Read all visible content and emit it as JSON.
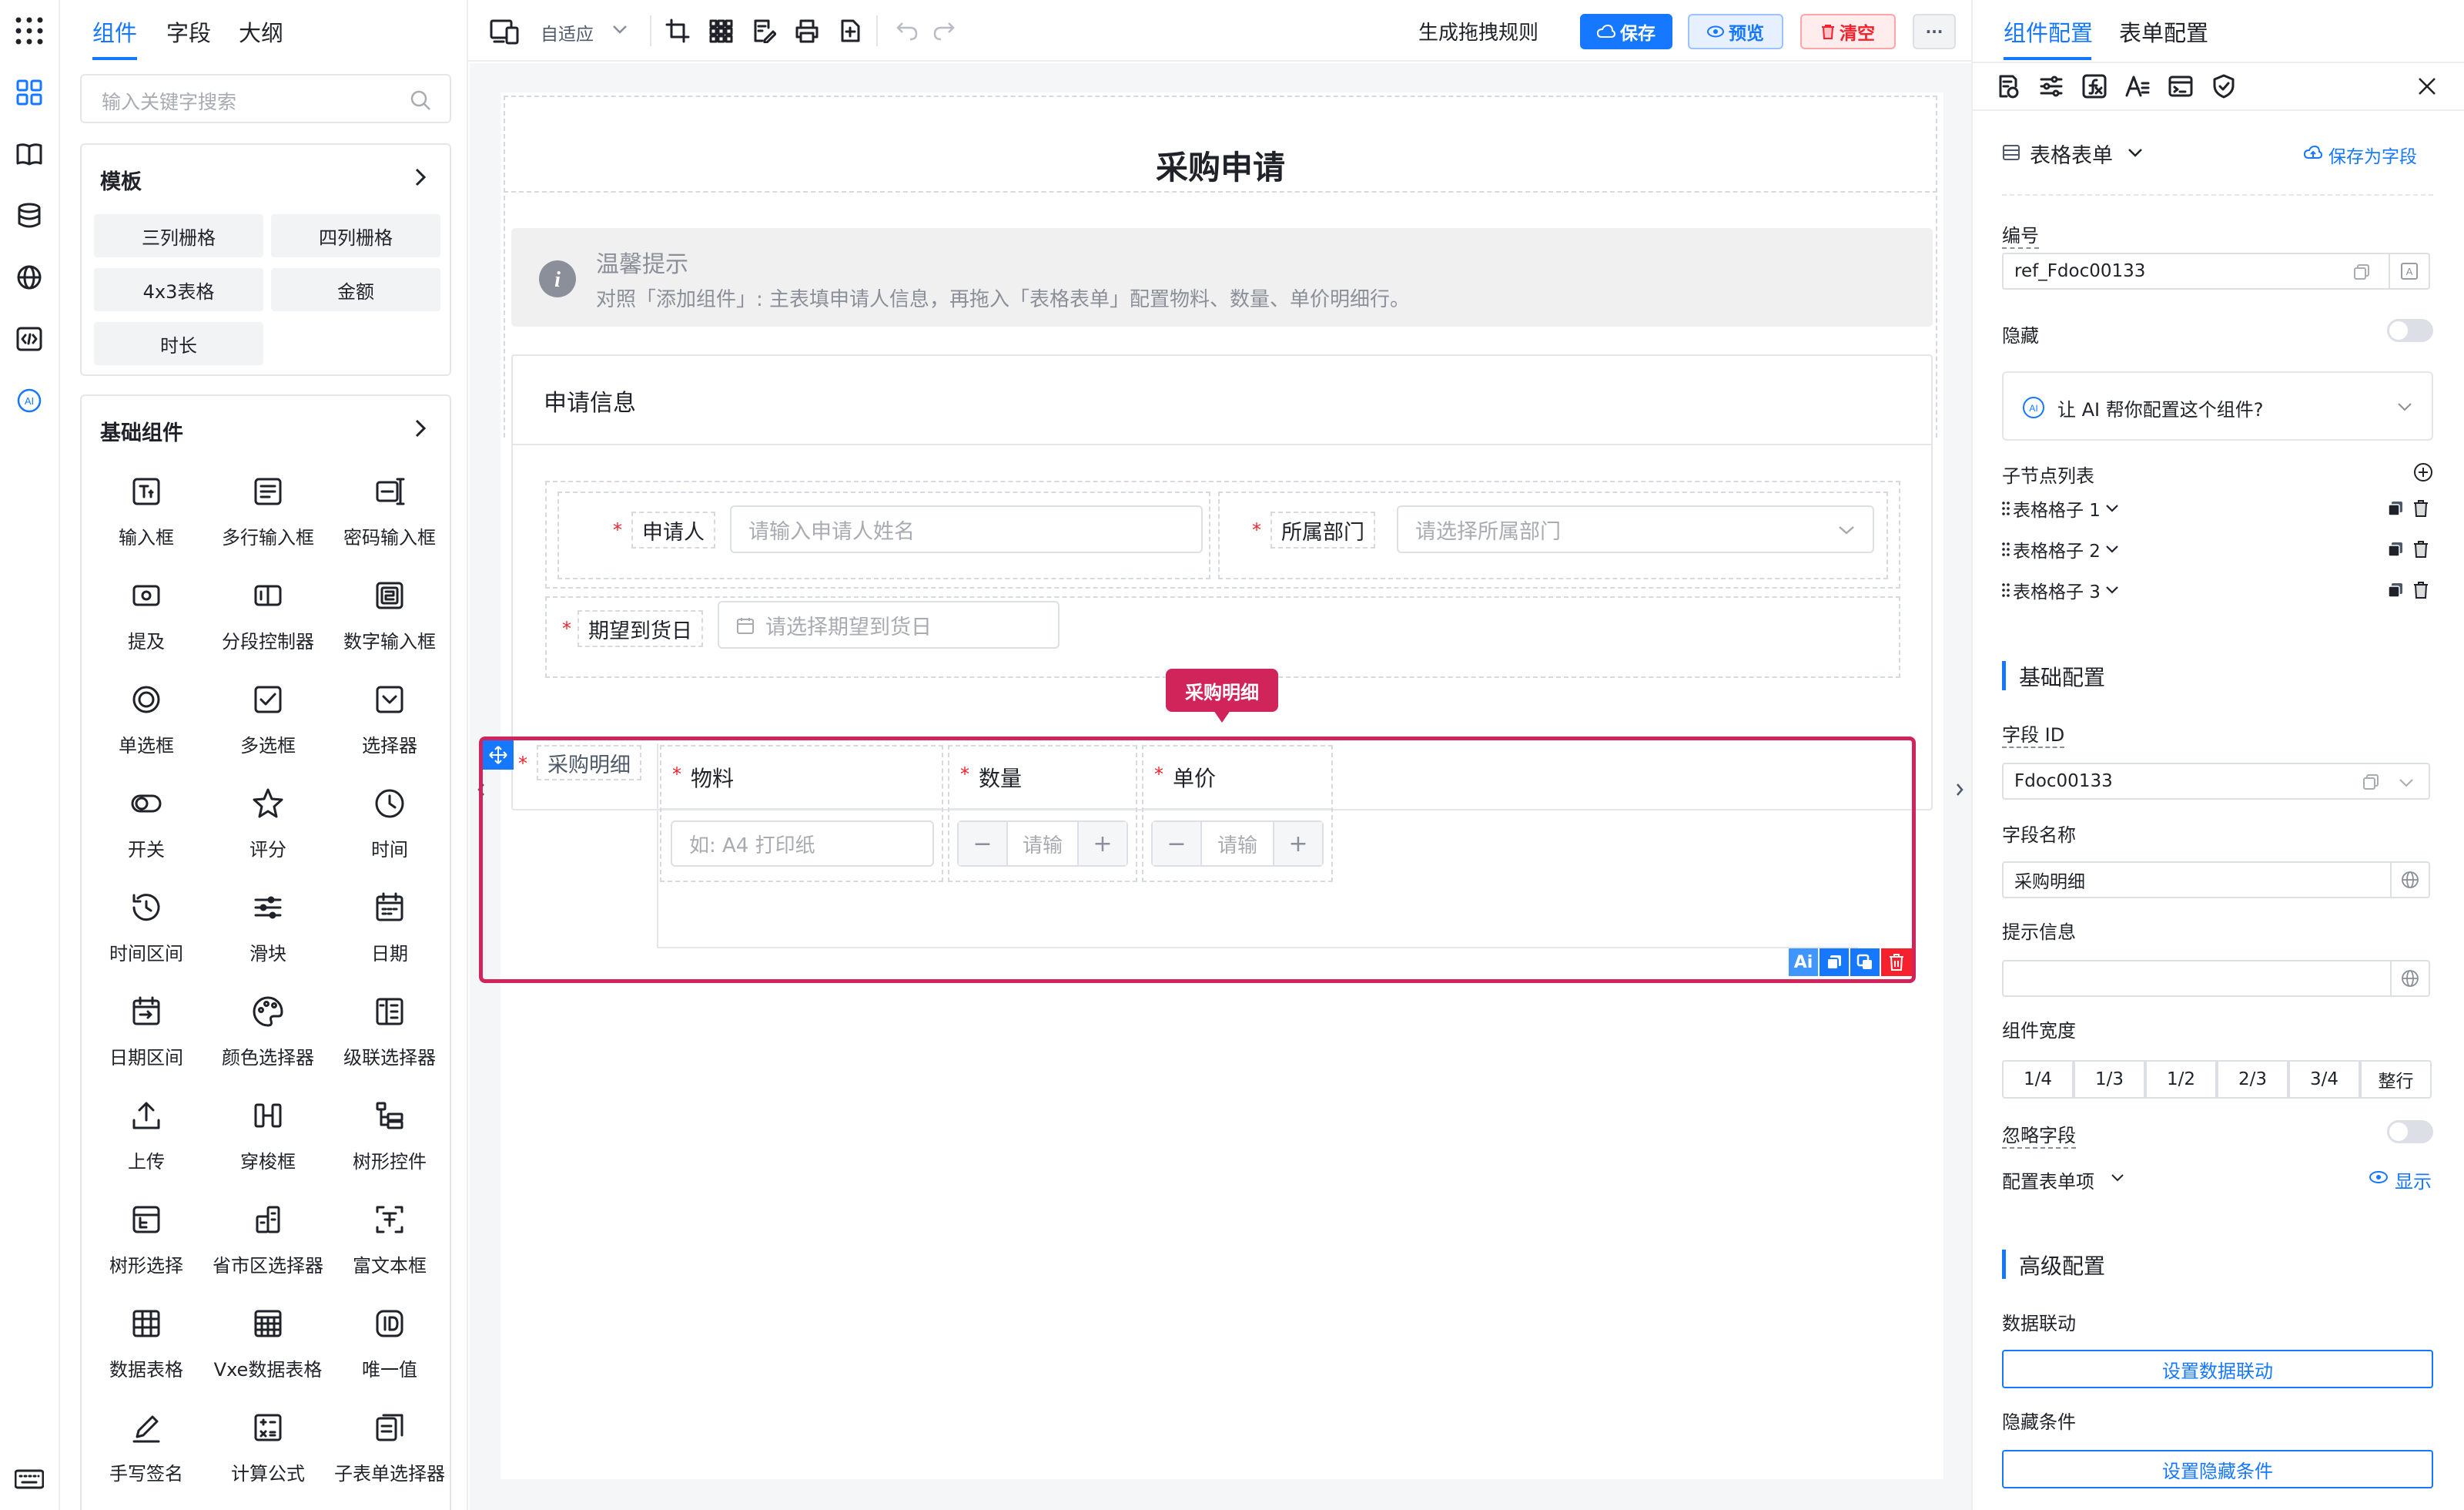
{
  "left_tabs": [
    "组件",
    "字段",
    "大纲"
  ],
  "search": {
    "placeholder": "输入关键字搜索"
  },
  "templates": {
    "title": "模板",
    "items": [
      "三列栅格",
      "四列栅格",
      "4x3表格",
      "金额",
      "时长"
    ]
  },
  "basic": {
    "title": "基础组件",
    "items": [
      {
        "label": "输入框",
        "icon": "input-icon"
      },
      {
        "label": "多行输入框",
        "icon": "textarea-icon"
      },
      {
        "label": "密码输入框",
        "icon": "password-icon"
      },
      {
        "label": "提及",
        "icon": "mention-icon"
      },
      {
        "label": "分段控制器",
        "icon": "segmented-icon"
      },
      {
        "label": "数字输入框",
        "icon": "number-icon"
      },
      {
        "label": "单选框",
        "icon": "radio-icon"
      },
      {
        "label": "多选框",
        "icon": "checkbox-icon"
      },
      {
        "label": "选择器",
        "icon": "select-icon"
      },
      {
        "label": "开关",
        "icon": "switch-icon"
      },
      {
        "label": "评分",
        "icon": "star-icon"
      },
      {
        "label": "时间",
        "icon": "clock-icon"
      },
      {
        "label": "时间区间",
        "icon": "history-icon"
      },
      {
        "label": "滑块",
        "icon": "slider-icon"
      },
      {
        "label": "日期",
        "icon": "calendar-icon"
      },
      {
        "label": "日期区间",
        "icon": "date-range-icon"
      },
      {
        "label": "颜色选择器",
        "icon": "palette-icon"
      },
      {
        "label": "级联选择器",
        "icon": "cascader-icon"
      },
      {
        "label": "上传",
        "icon": "upload-icon"
      },
      {
        "label": "穿梭框",
        "icon": "transfer-icon"
      },
      {
        "label": "树形控件",
        "icon": "tree-icon"
      },
      {
        "label": "树形选择",
        "icon": "tree-select-icon"
      },
      {
        "label": "省市区选择器",
        "icon": "region-icon"
      },
      {
        "label": "富文本框",
        "icon": "rich-text-icon"
      },
      {
        "label": "数据表格",
        "icon": "table-icon"
      },
      {
        "label": "Vxe数据表格",
        "icon": "vxe-table-icon"
      },
      {
        "label": "唯一值",
        "icon": "id-icon"
      },
      {
        "label": "手写签名",
        "icon": "signature-icon"
      },
      {
        "label": "计算公式",
        "icon": "calculator-icon"
      },
      {
        "label": "子表单选择器",
        "icon": "subform-icon"
      }
    ]
  },
  "toolbar": {
    "adaptive": "自适应",
    "gen_rules": "生成拖拽规则",
    "save": "保存",
    "preview": "预览",
    "clear": "清空",
    "more": "···"
  },
  "form": {
    "title": "采购申请",
    "tip": {
      "title": "温馨提示",
      "text": "对照「添加组件」: 主表填申请人信息，再拖入「表格表单」配置物料、数量、单价明细行。"
    },
    "section_title": "申请信息",
    "applicant": {
      "label": "申请人",
      "placeholder": "请输入申请人姓名"
    },
    "department": {
      "label": "所属部门",
      "placeholder": "请选择所属部门"
    },
    "delivery": {
      "label": "期望到货日",
      "placeholder": "请选择期望到货日"
    },
    "detail": {
      "badge": "采购明细",
      "label": "采购明细",
      "columns": [
        {
          "label": "物料",
          "placeholder": "如: A4 打印纸"
        },
        {
          "label": "数量",
          "placeholder": "请输"
        },
        {
          "label": "单价",
          "placeholder": "请输"
        }
      ],
      "actions": [
        "Ai"
      ]
    }
  },
  "right": {
    "tabs": [
      "组件配置",
      "表单配置"
    ],
    "type": "表格表单",
    "save_as_field": "保存为字段",
    "ref_label": "编号",
    "ref_value": "ref_Fdoc00133",
    "hidden_label": "隐藏",
    "ai_prompt": "让 AI 帮你配置这个组件?",
    "children_label": "子节点列表",
    "children": [
      "表格格子 1",
      "表格格子 2",
      "表格格子 3"
    ],
    "basic_title": "基础配置",
    "field_id_label": "字段 ID",
    "field_id": "Fdoc00133",
    "field_name_label": "字段名称",
    "field_name": "采购明细",
    "tip_label": "提示信息",
    "width_label": "组件宽度",
    "widths": [
      "1/4",
      "1/3",
      "1/2",
      "2/3",
      "3/4",
      "整行"
    ],
    "ignore_label": "忽略字段",
    "form_items_label": "配置表单项",
    "show": "显示",
    "advanced_title": "高级配置",
    "linkage_label": "数据联动",
    "linkage_btn": "设置数据联动",
    "hide_cond_label": "隐藏条件",
    "hide_cond_btn": "设置隐藏条件"
  },
  "colors": {
    "accent": "#1677ff",
    "selected": "#d1245a",
    "danger": "#f5222d"
  }
}
